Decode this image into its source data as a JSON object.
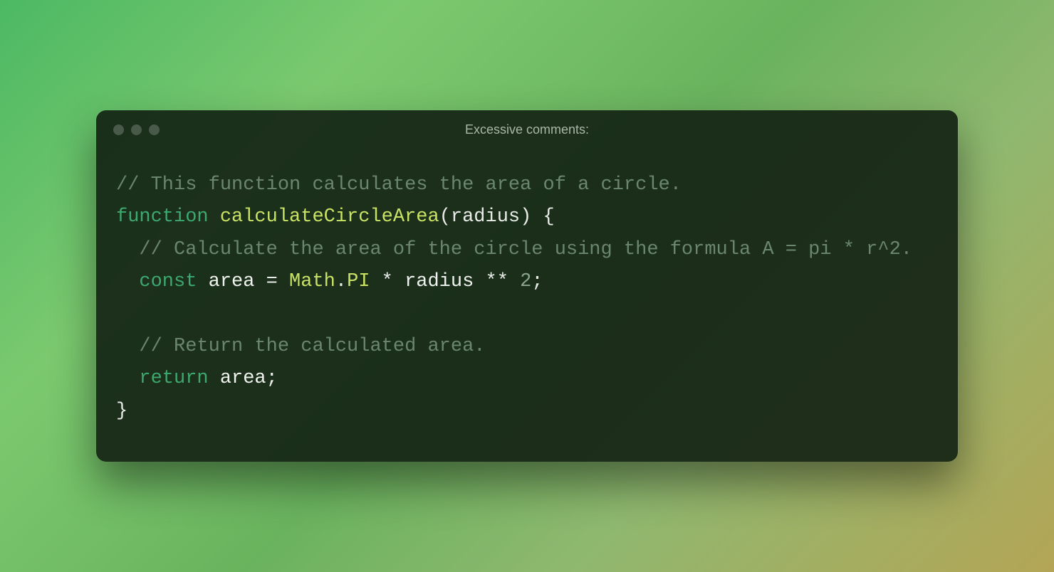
{
  "window": {
    "title": "Excessive comments:"
  },
  "code": {
    "line1_comment": "// This function calculates the area of a circle.",
    "kw_function": "function",
    "func_name": "calculateCircleArea",
    "paren_open": "(",
    "param_radius": "radius",
    "paren_close": ")",
    "brace_open": " {",
    "line3_comment": "  // Calculate the area of the circle using the formula A = pi * r^2.",
    "indent2": "  ",
    "kw_const": "const",
    "sp": " ",
    "ident_area": "area",
    "eq": " = ",
    "builtin_math": "Math",
    "dot": ".",
    "prop_pi": "PI",
    "op_mul": " * ",
    "ident_radius": "radius",
    "op_pow": " ** ",
    "num_two": "2",
    "semi": ";",
    "line_blank": "",
    "line6_comment": "  // Return the calculated area.",
    "kw_return": "return",
    "ident_area2": "area",
    "brace_close": "}"
  }
}
